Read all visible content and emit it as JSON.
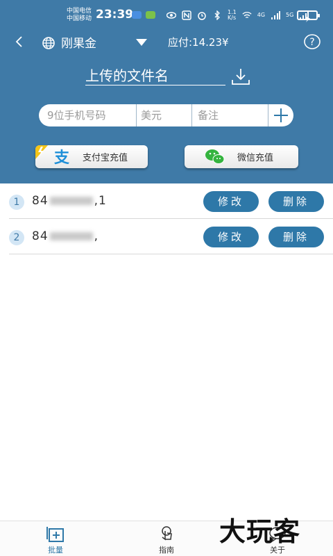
{
  "status": {
    "carrier1": "中国电信",
    "carrier2": "中国移动",
    "time": "23:39",
    "net_speed_top": "1.1",
    "net_speed_unit": "K/s",
    "signal1": "4G",
    "signal2": "5G"
  },
  "header": {
    "metal": "刚果金",
    "price": "应付:14.23¥",
    "filename": "上传的文件名"
  },
  "inputs": {
    "phone_placeholder": "9位手机号码",
    "usd_placeholder": "美元",
    "note_placeholder": "备注"
  },
  "recharge": {
    "alipay_label": "支付宝充值",
    "wechat_label": "微信充值",
    "alipay_glyph": "支"
  },
  "list": [
    {
      "index": "1",
      "prefix": "84",
      "suffix": ",1",
      "edit": "修改",
      "delete": "删除"
    },
    {
      "index": "2",
      "prefix": "84",
      "suffix": ",",
      "edit": "修改",
      "delete": "删除"
    }
  ],
  "nav": [
    {
      "label": "批量",
      "active": true
    },
    {
      "label": "指南",
      "active": false
    },
    {
      "label": "关于",
      "active": false
    }
  ],
  "watermark": "大玩客",
  "colors": {
    "header_bg": "#3f7aa7",
    "button_blue": "#2e78a8",
    "wechat_green": "#35b43f",
    "alipay_blue": "#1e8fd8",
    "alipay_yellow": "#f5c518"
  }
}
